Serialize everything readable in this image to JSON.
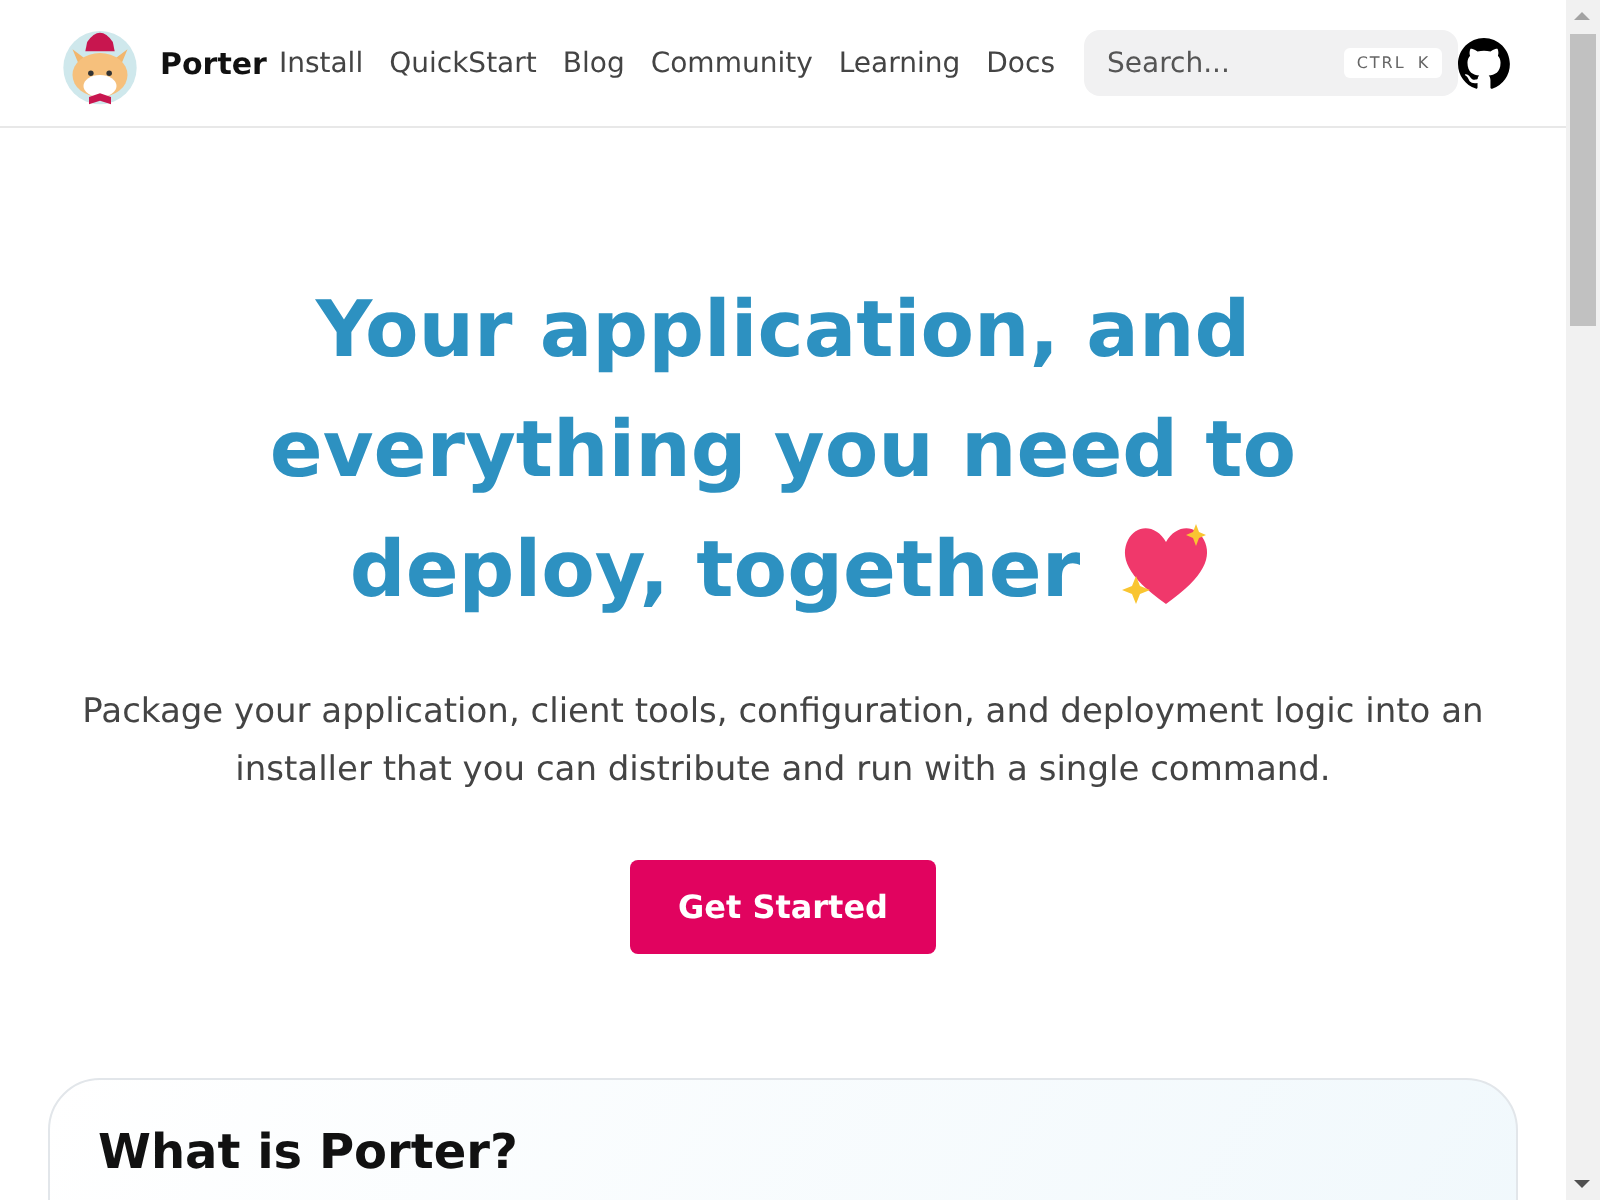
{
  "header": {
    "brand": "Porter",
    "nav": [
      {
        "label": "Install"
      },
      {
        "label": "QuickStart"
      },
      {
        "label": "Blog"
      },
      {
        "label": "Community"
      },
      {
        "label": "Learning"
      },
      {
        "label": "Docs"
      }
    ],
    "search": {
      "placeholder": "Search...",
      "shortcut": [
        "CTRL",
        "K"
      ]
    }
  },
  "hero": {
    "title_lines": [
      "Your application, and",
      "everything you need to",
      "deploy, together"
    ],
    "subtitle": "Package your application, client tools, configuration, and deployment logic into an installer that you can distribute and run with a single command.",
    "button": "Get Started"
  },
  "section": {
    "heading": "What is Porter?"
  }
}
